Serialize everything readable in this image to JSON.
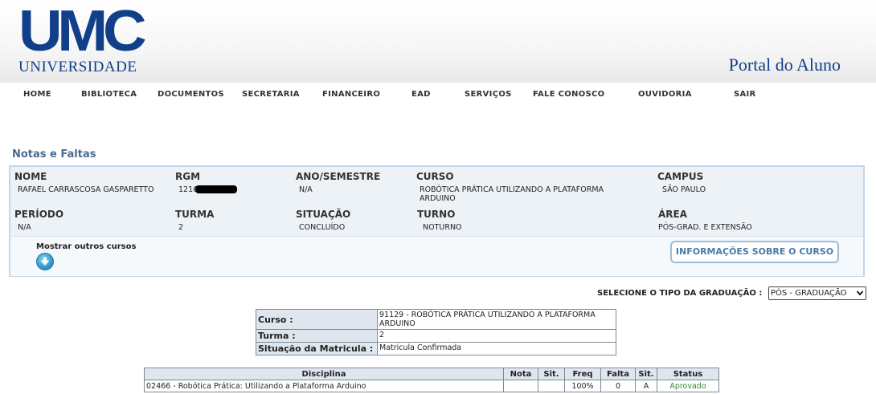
{
  "header": {
    "logo_text": "UMC",
    "logo_sub": "UNIVERSIDADE",
    "portal_title": "Portal do Aluno"
  },
  "nav": [
    "HOME",
    "BIBLIOTECA",
    "DOCUMENTOS",
    "SECRETARIA",
    "FINANCEIRO",
    "EAD",
    "SERVIÇOS",
    "FALE CONOSCO",
    "OUVIDORIA",
    "SAIR"
  ],
  "section_title": "Notas e Faltas",
  "student": {
    "nome_label": "NOME",
    "nome": "RAFAEL CARRASCOSA GASPARETTO",
    "rgm_label": "RGM",
    "rgm": "1216",
    "ano_label": "ANO/SEMESTRE",
    "ano": "N/A",
    "curso_label": "CURSO",
    "curso": "ROBÓTICA PRÁTICA UTILIZANDO A PLATAFORMA ARDUINO",
    "campus_label": "CAMPUS",
    "campus": "SÃO PAULO",
    "periodo_label": "PERÍODO",
    "periodo": "N/A",
    "turma_label": "TURMA",
    "turma": "2",
    "situacao_label": "SITUAÇÃO",
    "situacao": "CONCLUÍDO",
    "turno_label": "TURNO",
    "turno": "NOTURNO",
    "area_label": "ÁREA",
    "area": "PÓS-GRAD. E EXTENSÃO"
  },
  "mostrar_label": "Mostrar outros cursos",
  "info_button": "INFORMAÇÕES SOBRE O CURSO",
  "grad_select": {
    "label": "SELECIONE O TIPO DA GRADUAÇÃO :",
    "value": "PÓS - GRADUAÇÃO"
  },
  "curso_table": {
    "curso_label": "Curso :",
    "curso_value": "91129 - ROBÓTICA PRÁTICA UTILIZANDO A PLATAFORMA ARDUINO",
    "turma_label": "Turma :",
    "turma_value": "2",
    "situacao_label": "Situação da Matricula :",
    "situacao_value": "Matricula Confirmada"
  },
  "disciplinas": {
    "headers": [
      "Disciplina",
      "Nota",
      "Sit.",
      "Freq",
      "Falta",
      "Sit.",
      "Status"
    ],
    "rows": [
      [
        "02466 - Robótica Prática: Utilizando a Plataforma Arduino",
        "",
        "",
        "100%",
        "0",
        "A",
        "Aprovado"
      ]
    ]
  },
  "colors": {
    "brand": "#123f8a",
    "accent": "#4a6a8e",
    "status_ok": "#2f8a2f"
  }
}
